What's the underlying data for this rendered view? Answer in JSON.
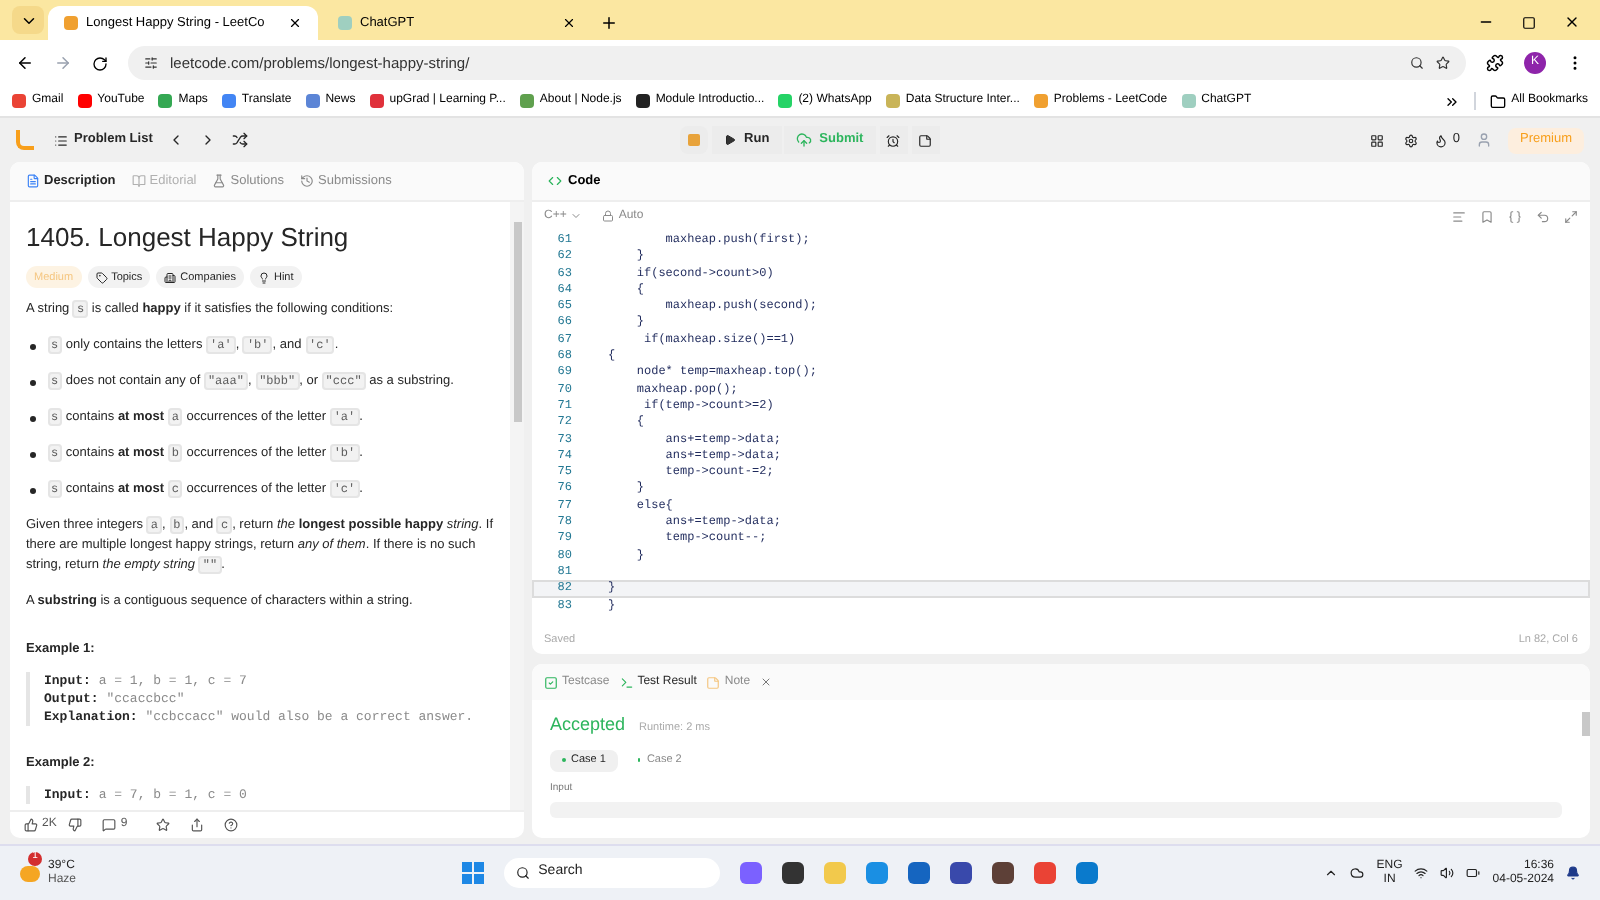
{
  "browser": {
    "tabs": [
      {
        "title": "Longest Happy String - LeetCo",
        "selected": true
      },
      {
        "title": "ChatGPT",
        "selected": false
      }
    ],
    "url": "leetcode.com/problems/longest-happy-string/",
    "profile": "K",
    "bookmarks": [
      {
        "label": "Gmail",
        "color": "#ea4335"
      },
      {
        "label": "YouTube",
        "color": "#ff0000"
      },
      {
        "label": "Maps",
        "color": "#34a853"
      },
      {
        "label": "Translate",
        "color": "#4285f4"
      },
      {
        "label": "News",
        "color": "#5c85d6"
      },
      {
        "label": "upGrad | Learning P...",
        "color": "#e0313b"
      },
      {
        "label": "About | Node.js",
        "color": "#5fa04e"
      },
      {
        "label": "Module Introductio...",
        "color": "#222222"
      },
      {
        "label": "(2) WhatsApp",
        "color": "#25d366"
      },
      {
        "label": "Data Structure Inter...",
        "color": "#c9b458"
      },
      {
        "label": "Problems - LeetCode",
        "color": "#f0a030"
      },
      {
        "label": "ChatGPT",
        "color": "#9fcfc0"
      }
    ],
    "all_bookmarks": "All Bookmarks"
  },
  "toolbar": {
    "problem_list": "Problem List",
    "run": "Run",
    "submit": "Submit",
    "streak": "0",
    "premium": "Premium"
  },
  "description": {
    "tabs": [
      {
        "label": "Description",
        "selected": true,
        "disabled": false
      },
      {
        "label": "Editorial",
        "selected": false,
        "disabled": true
      },
      {
        "label": "Solutions",
        "selected": false,
        "disabled": false
      },
      {
        "label": "Submissions",
        "selected": false,
        "disabled": false
      }
    ],
    "title": "1405. Longest Happy String",
    "tags": [
      {
        "kind": "difficulty",
        "label": "Medium"
      },
      {
        "kind": "topics",
        "label": "Topics"
      },
      {
        "kind": "companies",
        "label": "Companies"
      },
      {
        "kind": "hint",
        "label": "Hint"
      }
    ],
    "blocks": [
      {
        "kind": "para",
        "parts": [
          {
            "kind": "text",
            "text": "A string "
          },
          {
            "kind": "code",
            "text": "s"
          },
          {
            "kind": "text",
            "text": " is called **happy** if it satisfies the following conditions:"
          }
        ]
      },
      {
        "kind": "bullet",
        "parts": [
          {
            "kind": "code",
            "text": "s"
          },
          {
            "kind": "text",
            "text": " only contains the letters "
          },
          {
            "kind": "code",
            "text": "'a'"
          },
          {
            "kind": "text",
            "text": ", "
          },
          {
            "kind": "code",
            "text": "'b'"
          },
          {
            "kind": "text",
            "text": ", and "
          },
          {
            "kind": "code",
            "text": "'c'"
          },
          {
            "kind": "text",
            "text": "."
          }
        ]
      },
      {
        "kind": "bullet",
        "parts": [
          {
            "kind": "code",
            "text": "s"
          },
          {
            "kind": "text",
            "text": " does not contain any of "
          },
          {
            "kind": "code",
            "text": "\"aaa\""
          },
          {
            "kind": "text",
            "text": ", "
          },
          {
            "kind": "code",
            "text": "\"bbb\""
          },
          {
            "kind": "text",
            "text": ", or "
          },
          {
            "kind": "code",
            "text": "\"ccc\""
          },
          {
            "kind": "text",
            "text": " as a substring."
          }
        ]
      },
      {
        "kind": "bullet",
        "parts": [
          {
            "kind": "code",
            "text": "s"
          },
          {
            "kind": "text",
            "text": " contains **at most** "
          },
          {
            "kind": "code",
            "text": "a"
          },
          {
            "kind": "text",
            "text": " occurrences of the letter "
          },
          {
            "kind": "code",
            "text": "'a'"
          },
          {
            "kind": "text",
            "text": "."
          }
        ]
      },
      {
        "kind": "bullet",
        "parts": [
          {
            "kind": "code",
            "text": "s"
          },
          {
            "kind": "text",
            "text": " contains **at most** "
          },
          {
            "kind": "code",
            "text": "b"
          },
          {
            "kind": "text",
            "text": " occurrences of the letter "
          },
          {
            "kind": "code",
            "text": "'b'"
          },
          {
            "kind": "text",
            "text": "."
          }
        ]
      },
      {
        "kind": "bullet",
        "parts": [
          {
            "kind": "code",
            "text": "s"
          },
          {
            "kind": "text",
            "text": " contains **at most** "
          },
          {
            "kind": "code",
            "text": "c"
          },
          {
            "kind": "text",
            "text": " occurrences of the letter "
          },
          {
            "kind": "code",
            "text": "'c'"
          },
          {
            "kind": "text",
            "text": "."
          }
        ]
      },
      {
        "kind": "para",
        "parts": [
          {
            "kind": "text",
            "text": "Given three integers "
          },
          {
            "kind": "code",
            "text": "a"
          },
          {
            "kind": "text",
            "text": ", "
          },
          {
            "kind": "code",
            "text": "b"
          },
          {
            "kind": "text",
            "text": ", and "
          },
          {
            "kind": "code",
            "text": "c"
          },
          {
            "kind": "text",
            "text": ", return *the* **longest possible happy** *string*. If there are multiple longest happy strings, return *any of them*. If there is no such string, return *the empty string* "
          },
          {
            "kind": "code",
            "text": "\"\""
          },
          {
            "kind": "text",
            "text": "."
          }
        ]
      },
      {
        "kind": "para",
        "parts": [
          {
            "kind": "text",
            "text": "A **substring** is a contiguous sequence of characters within a string."
          }
        ]
      },
      {
        "kind": "example",
        "title": "Example 1:",
        "lines": [
          {
            "label": "Input:",
            "value": "a = 1, b = 1, c = 7"
          },
          {
            "label": "Output:",
            "value": "\"ccaccbcc\""
          },
          {
            "label": "Explanation:",
            "value": "\"ccbccacc\" would also be a correct answer."
          }
        ]
      },
      {
        "kind": "example",
        "title": "Example 2:",
        "lines": [
          {
            "label": "Input:",
            "value": "a = 7, b = 1, c = 0"
          }
        ]
      }
    ],
    "likes": "2K",
    "comments": "9"
  },
  "code": {
    "tab": "Code",
    "language": "C++",
    "mode": "Auto",
    "lines": [
      {
        "number": "61",
        "code": "        maxheap.push(first);",
        "current": false
      },
      {
        "number": "62",
        "code": "    }",
        "current": false
      },
      {
        "number": "63",
        "code": "    if(second->count>0)",
        "current": false
      },
      {
        "number": "64",
        "code": "    {",
        "current": false
      },
      {
        "number": "65",
        "code": "        maxheap.push(second);",
        "current": false
      },
      {
        "number": "66",
        "code": "    }",
        "current": false
      },
      {
        "number": "67",
        "code": "     if(maxheap.size()==1)",
        "current": false
      },
      {
        "number": "68",
        "code": "{",
        "current": false
      },
      {
        "number": "69",
        "code": "    node* temp=maxheap.top();",
        "current": false
      },
      {
        "number": "70",
        "code": "    maxheap.pop();",
        "current": false
      },
      {
        "number": "71",
        "code": "     if(temp->count>=2)",
        "current": false
      },
      {
        "number": "72",
        "code": "    {",
        "current": false
      },
      {
        "number": "73",
        "code": "        ans+=temp->data;",
        "current": false
      },
      {
        "number": "74",
        "code": "        ans+=temp->data;",
        "current": false
      },
      {
        "number": "75",
        "code": "        temp->count-=2;",
        "current": false
      },
      {
        "number": "76",
        "code": "    }",
        "current": false
      },
      {
        "number": "77",
        "code": "    else{",
        "current": false
      },
      {
        "number": "78",
        "code": "        ans+=temp->data;",
        "current": false
      },
      {
        "number": "79",
        "code": "        temp->count--;",
        "current": false
      },
      {
        "number": "80",
        "code": "    }",
        "current": false
      },
      {
        "number": "81",
        "current": false
      },
      {
        "number": "82",
        "code": "}",
        "current": true
      },
      {
        "number": "83",
        "code": "}",
        "current": false
      }
    ],
    "status": "Saved",
    "position": "Ln 82, Col 6"
  },
  "results": {
    "tabs": [
      {
        "label": "Testcase",
        "selected": false
      },
      {
        "label": "Test Result",
        "selected": true
      },
      {
        "label": "Note",
        "selected": false
      }
    ],
    "verdict": "Accepted",
    "runtime": "Runtime: 2 ms",
    "cases": [
      {
        "label": "Case 1",
        "selected": true
      },
      {
        "label": "Case 2",
        "selected": false
      }
    ],
    "input_label": "Input"
  },
  "taskbar": {
    "temperature": "39°C",
    "weather": "Haze",
    "badge": "1",
    "search": "Search",
    "lang": "ENG",
    "region": "IN",
    "time": "16:36",
    "date": "04-05-2024"
  }
}
